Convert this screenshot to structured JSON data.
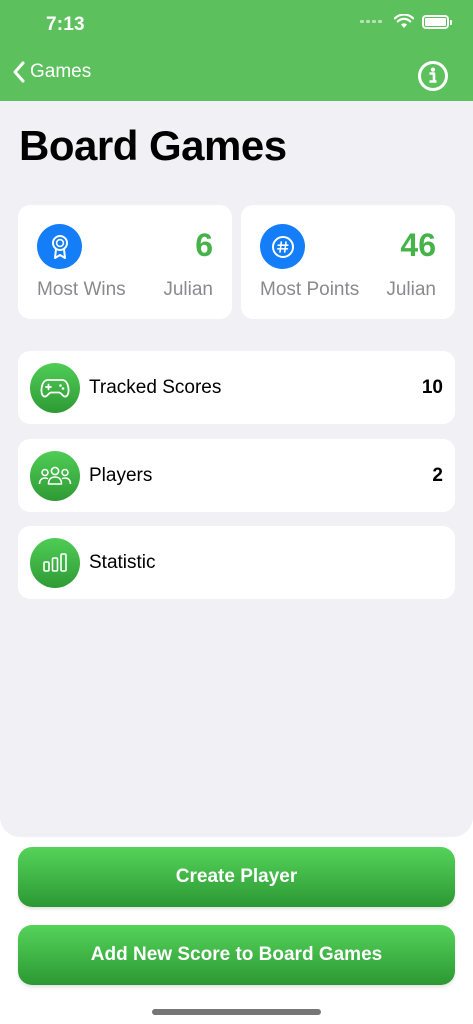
{
  "status_bar": {
    "time": "7:13"
  },
  "nav": {
    "back_label": "Games"
  },
  "page": {
    "title": "Board Games"
  },
  "stats": [
    {
      "value": "6",
      "label": "Most Wins",
      "name": "Julian",
      "icon": "award-ribbon-icon"
    },
    {
      "value": "46",
      "label": "Most Points",
      "name": "Julian",
      "icon": "hash-points-icon"
    }
  ],
  "rows": [
    {
      "label": "Tracked Scores",
      "count": "10",
      "icon": "gamecontroller-icon"
    },
    {
      "label": "Players",
      "count": "2",
      "icon": "players-group-icon"
    },
    {
      "label": "Statistic",
      "count": "",
      "icon": "bar-chart-icon"
    }
  ],
  "actions": {
    "create_player": "Create Player",
    "add_score": "Add New Score to Board Games"
  },
  "colors": {
    "header_green": "#5cc15d",
    "value_green": "#45b34a",
    "icon_blue": "#137ef8",
    "background": "#f0f0f5"
  }
}
